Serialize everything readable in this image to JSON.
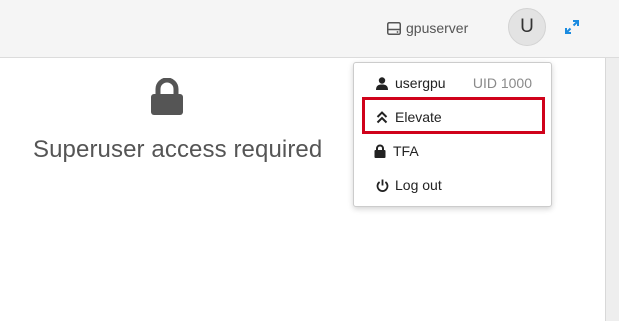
{
  "topbar": {
    "server_name": "gpuserver",
    "server_icon": "server-icon",
    "avatar_initial": "U",
    "expand_icon": "expand-icon"
  },
  "main": {
    "lock_icon": "lock-icon",
    "message": "Superuser access required"
  },
  "menu": {
    "user": {
      "icon": "user-icon",
      "label": "usergpu",
      "uid": "UID 1000"
    },
    "elevate": {
      "icon": "chevrons-up-icon",
      "label": "Elevate"
    },
    "tfa": {
      "icon": "lock-icon",
      "label": "TFA"
    },
    "logout": {
      "icon": "power-icon",
      "label": "Log out"
    }
  },
  "colors": {
    "highlight": "#d0021b",
    "accent": "#1a8be0"
  }
}
